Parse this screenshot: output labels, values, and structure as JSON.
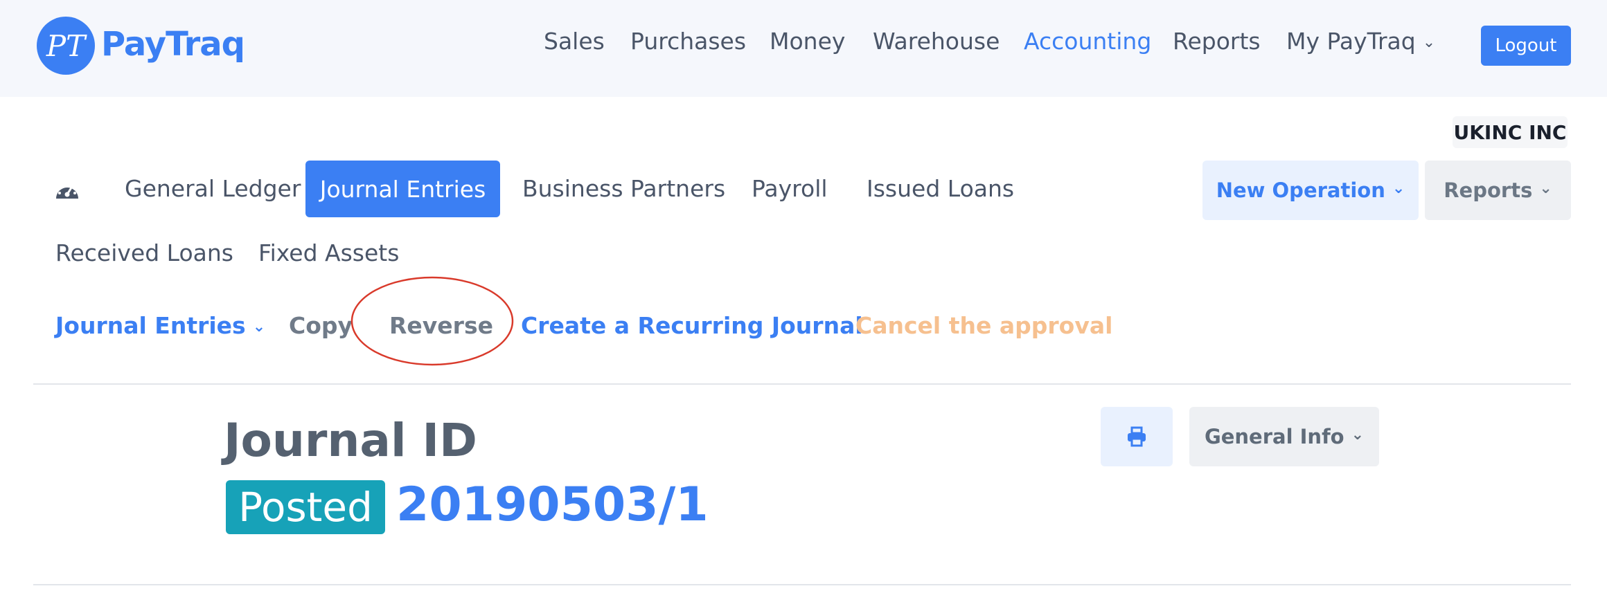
{
  "brand": {
    "logo_initials": "PT",
    "name": "PayTraq"
  },
  "top_nav": {
    "items": [
      "Sales",
      "Purchases",
      "Money",
      "Warehouse",
      "Accounting",
      "Reports",
      "My PayTraq"
    ],
    "active": "Accounting",
    "logout_label": "Logout"
  },
  "company": "UKINC INC",
  "module_tabs": {
    "items": [
      "General Ledger",
      "Journal Entries",
      "Business Partners",
      "Payroll",
      "Issued Loans",
      "Received Loans",
      "Fixed Assets"
    ],
    "active": "Journal Entries"
  },
  "toolbar": {
    "new_operation_label": "New Operation",
    "reports_label": "Reports"
  },
  "actions": {
    "journal_entries_label": "Journal Entries",
    "copy_label": "Copy",
    "reverse_label": "Reverse",
    "recurring_label": "Create a Recurring Journal",
    "cancel_approval_label": "Cancel the approval"
  },
  "journal": {
    "title": "Journal ID",
    "status": "Posted",
    "id": "20190503/1",
    "general_info_label": "General Info"
  },
  "colors": {
    "accent": "#3b7ff3",
    "posted_badge": "#17a2b8",
    "disabled_action": "#f6c08f",
    "highlight_ellipse": "#d93a2b"
  },
  "icons": {
    "dashboard": "gauge-icon",
    "print": "printer-icon",
    "dropdown": "chevron-down-icon"
  }
}
